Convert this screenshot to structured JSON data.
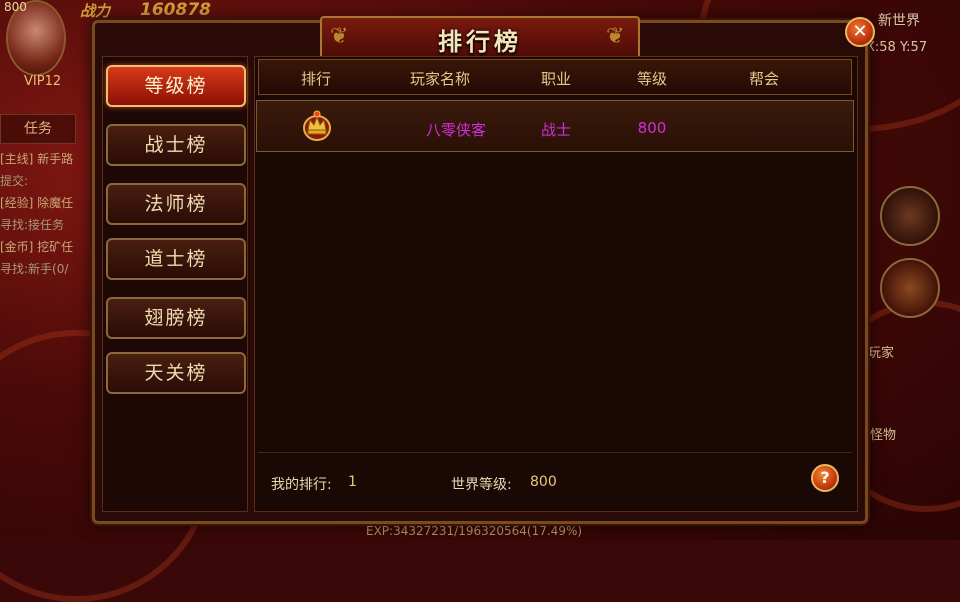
{
  "hud": {
    "level_num": "800",
    "vip": "VIP12",
    "power_label": "战力",
    "power": "160878",
    "map_name": "新世界",
    "coords": "X:58 Y:57",
    "task_tab": "任务",
    "quests": [
      "[主线] 新手路",
      "提交:",
      "[经验] 除魔任",
      "寻找:接任务",
      "[金币] 挖矿任",
      "寻找:新手(0/"
    ],
    "player_label": "玩家",
    "monster_label": "怪物",
    "exp": "EXP:34327231/196320564(17.49%)"
  },
  "dialog": {
    "title": "排行榜",
    "close_label": "✕",
    "tabs": [
      {
        "label": "等级榜",
        "active": true
      },
      {
        "label": "战士榜",
        "active": false
      },
      {
        "label": "法师榜",
        "active": false
      },
      {
        "label": "道士榜",
        "active": false
      },
      {
        "label": "翅膀榜",
        "active": false
      },
      {
        "label": "天关榜",
        "active": false
      }
    ],
    "columns": [
      "排行",
      "玩家名称",
      "职业",
      "等级",
      "帮会"
    ],
    "rows": [
      {
        "rank_icon": "crown-icon",
        "name": "八零侠客",
        "class": "战士",
        "level": "800",
        "guild": ""
      }
    ],
    "footer": {
      "my_rank_label": "我的排行:",
      "my_rank": "1",
      "world_level_label": "世界等级:",
      "world_level": "800"
    },
    "help_label": "?"
  },
  "colors": {
    "accent_gold": "#e4c88a",
    "row_text": "#d02ed8",
    "active_tab": "#d83a1a"
  }
}
